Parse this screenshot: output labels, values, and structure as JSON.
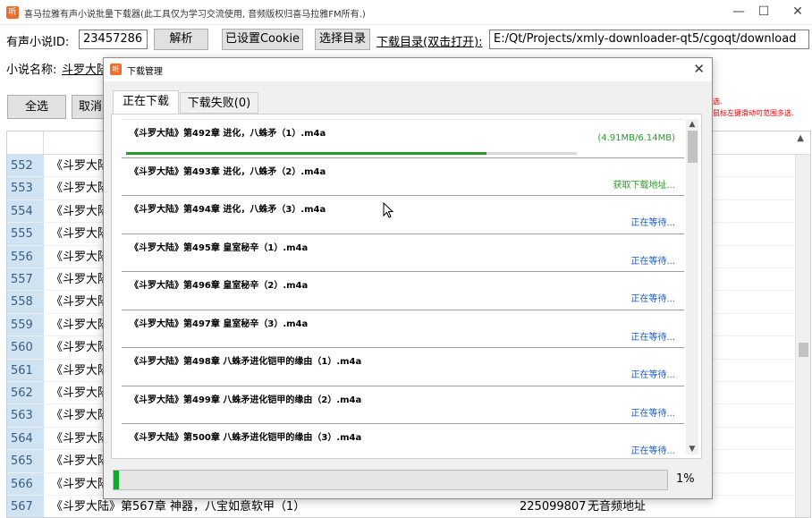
{
  "window": {
    "title": "喜马拉雅有声小说批量下载器(此工具仅为学习交流使用, 音频版权归喜马拉雅FM所有.)",
    "app_icon_text": "听",
    "minimize": "—",
    "maximize": "☐",
    "close": "✕"
  },
  "toolbar": {
    "novel_id_label": "有声小说ID:",
    "novel_id_value": "23457286",
    "parse_button": "解析",
    "cookie_button": "已设置Cookie",
    "choose_dir_button": "选择目录",
    "download_dir_link": "下载目录(双击打开):",
    "download_dir_value": "E:/Qt/Projects/xmly-downloader-qt5/cgoqt/download"
  },
  "novel": {
    "name_label": "小说名称:",
    "name_value": "斗罗大陆"
  },
  "actions": {
    "select_all": "全选",
    "cancel": "取消"
  },
  "hints": {
    "line1": "选.",
    "line2": "鼠标左键滑动可范围多选."
  },
  "table": {
    "rows": [
      {
        "num": "552",
        "title": "《斗罗大陆"
      },
      {
        "num": "553",
        "title": "《斗罗大陆"
      },
      {
        "num": "554",
        "title": "《斗罗大陆"
      },
      {
        "num": "555",
        "title": "《斗罗大陆"
      },
      {
        "num": "556",
        "title": "《斗罗大陆"
      },
      {
        "num": "557",
        "title": "《斗罗大陆"
      },
      {
        "num": "558",
        "title": "《斗罗大陆"
      },
      {
        "num": "559",
        "title": "《斗罗大陆"
      },
      {
        "num": "560",
        "title": "《斗罗大陆"
      },
      {
        "num": "561",
        "title": "《斗罗大陆"
      },
      {
        "num": "562",
        "title": "《斗罗大陆"
      },
      {
        "num": "563",
        "title": "《斗罗大陆"
      },
      {
        "num": "564",
        "title": "《斗罗大陆"
      },
      {
        "num": "565",
        "title": "《斗罗大陆"
      },
      {
        "num": "566",
        "title": "《斗罗大陆"
      },
      {
        "num": "567",
        "title": "《斗罗大陆》第567章 神器，八宝如意软甲（1）",
        "id": "225099807",
        "status": "无音频地址"
      }
    ]
  },
  "dialog": {
    "title": "下载管理",
    "icon_text": "听",
    "close": "✕",
    "tabs": [
      {
        "label": "正在下载"
      },
      {
        "label": "下载失败(0)"
      }
    ],
    "items": [
      {
        "name": "《斗罗大陆》第492章 进化，八蛛矛（1）.m4a",
        "status": "(4.91MB/6.14MB)",
        "kind": "progress",
        "progress": 0.8
      },
      {
        "name": "《斗罗大陆》第493章 进化，八蛛矛（2）.m4a",
        "status": "获取下载地址...",
        "kind": "fetch"
      },
      {
        "name": "《斗罗大陆》第494章 进化，八蛛矛（3）.m4a",
        "status": "正在等待...",
        "kind": "wait"
      },
      {
        "name": "《斗罗大陆》第495章 皇室秘辛（1）.m4a",
        "status": "正在等待...",
        "kind": "wait"
      },
      {
        "name": "《斗罗大陆》第496章 皇室秘辛（2）.m4a",
        "status": "正在等待...",
        "kind": "wait"
      },
      {
        "name": "《斗罗大陆》第497章 皇室秘辛（3）.m4a",
        "status": "正在等待...",
        "kind": "wait"
      },
      {
        "name": "《斗罗大陆》第498章 八蛛矛进化铠甲的缘由（1）.m4a",
        "status": "正在等待...",
        "kind": "wait"
      },
      {
        "name": "《斗罗大陆》第499章 八蛛矛进化铠甲的缘由（2）.m4a",
        "status": "正在等待...",
        "kind": "wait"
      },
      {
        "name": "《斗罗大陆》第500章 八蛛矛进化铠甲的缘由（3）.m4a",
        "status": "正在等待...",
        "kind": "wait"
      }
    ],
    "total_progress": 0.01,
    "total_label": "1%"
  },
  "colors": {
    "accent_green": "#06b025",
    "status_blue": "#1b5bc6",
    "status_green": "#2b9a2b",
    "row_header_bg": "#cfe3f3",
    "warning_red": "#e00000"
  }
}
